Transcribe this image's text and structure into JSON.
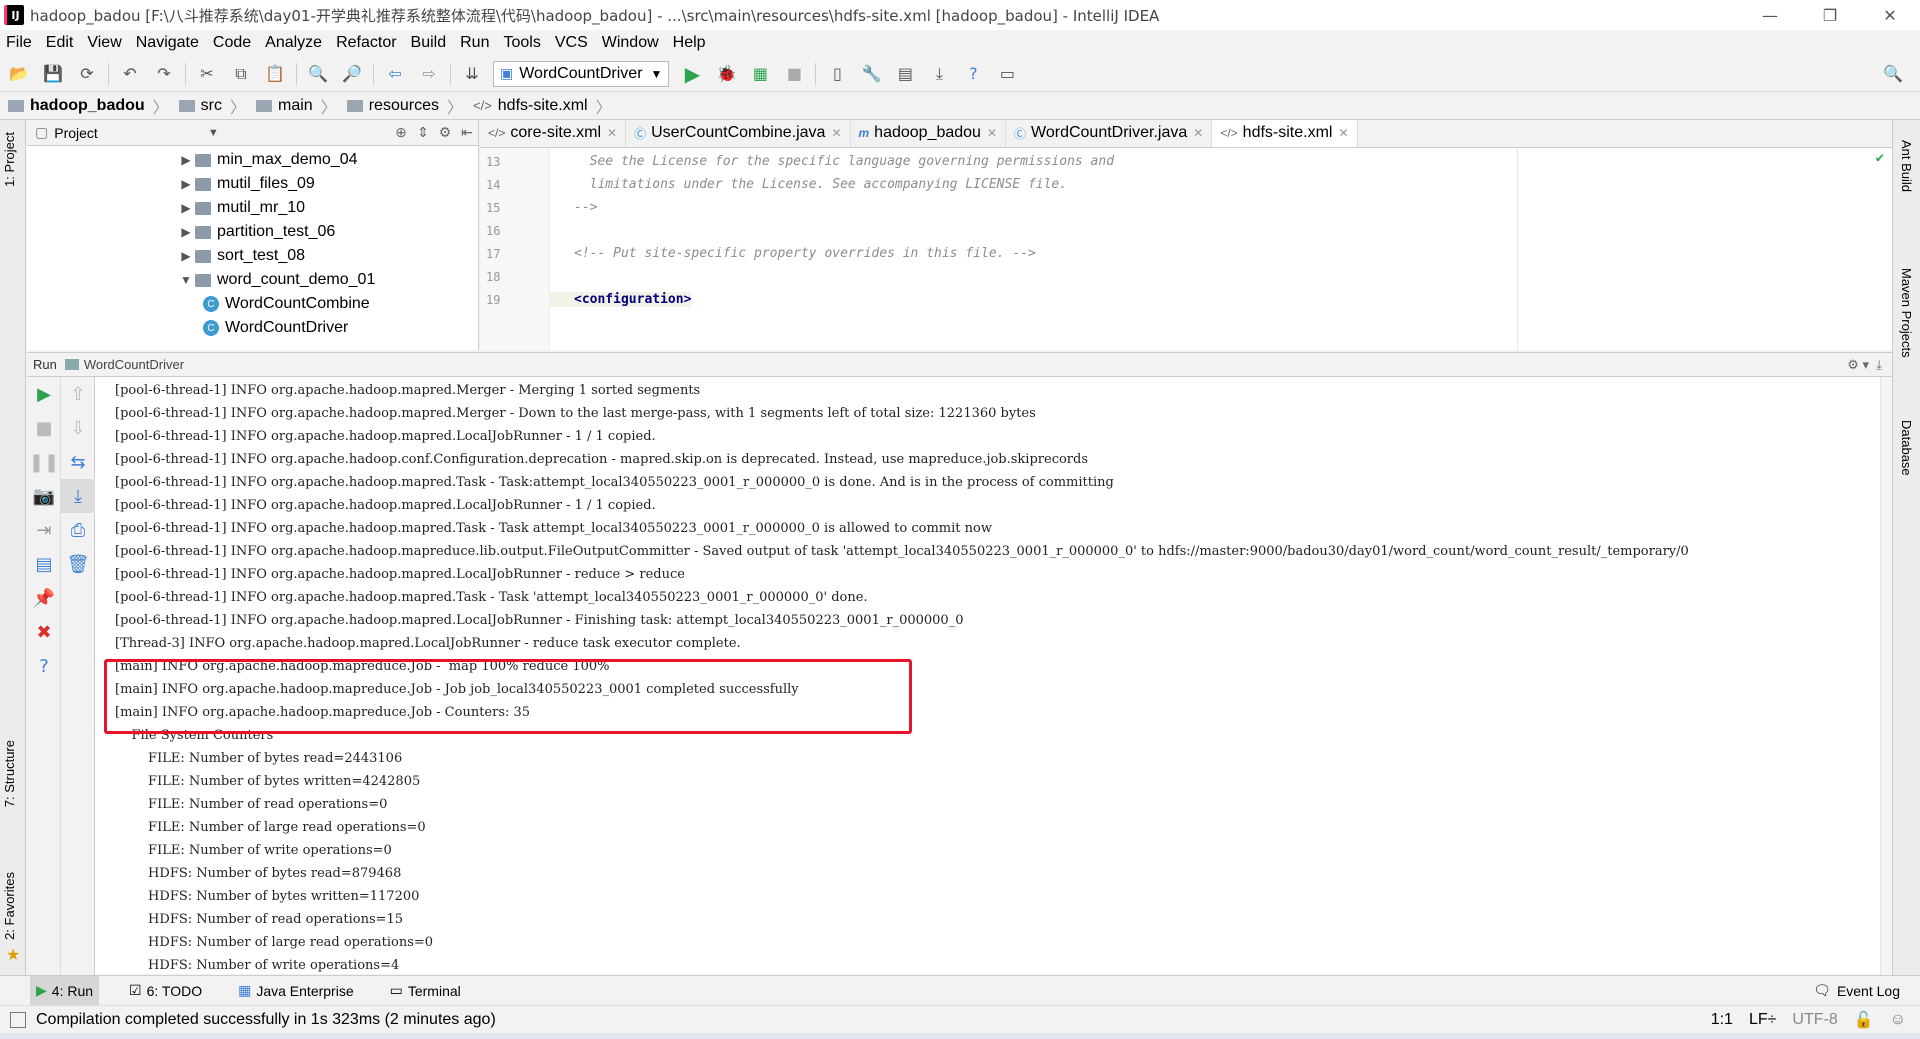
{
  "window": {
    "title": "hadoop_badou [F:\\八斗推荐系统\\day01-开学典礼推荐系统整体流程\\代码\\hadoop_badou] - ...\\src\\main\\resources\\hdfs-site.xml [hadoop_badou] - IntelliJ IDEA",
    "icon_label": "IJ"
  },
  "menu": [
    "File",
    "Edit",
    "View",
    "Navigate",
    "Code",
    "Analyze",
    "Refactor",
    "Build",
    "Run",
    "Tools",
    "VCS",
    "Window",
    "Help"
  ],
  "toolbar": {
    "run_config": "WordCountDriver"
  },
  "breadcrumb": [
    "hadoop_badou",
    "src",
    "main",
    "resources",
    "hdfs-site.xml"
  ],
  "left_stripe": {
    "project": "1: Project",
    "structure": "7: Structure",
    "favorites": "2: Favorites"
  },
  "right_stripe": {
    "ant": "Ant Build",
    "maven": "Maven Projects",
    "database": "Database"
  },
  "project_panel": {
    "title": "Project",
    "items": [
      {
        "label": "min_max_demo_04",
        "kind": "folder",
        "expanded": false
      },
      {
        "label": "mutil_files_09",
        "kind": "folder",
        "expanded": false
      },
      {
        "label": "mutil_mr_10",
        "kind": "folder",
        "expanded": false
      },
      {
        "label": "partition_test_06",
        "kind": "folder",
        "expanded": false
      },
      {
        "label": "sort_test_08",
        "kind": "folder",
        "expanded": false
      },
      {
        "label": "word_count_demo_01",
        "kind": "folder",
        "expanded": true
      },
      {
        "label": "WordCountCombine",
        "kind": "class"
      },
      {
        "label": "WordCountDriver",
        "kind": "class"
      }
    ]
  },
  "editor": {
    "tabs": [
      {
        "label": "core-site.xml",
        "icon": "xml-icon",
        "active": false
      },
      {
        "label": "UserCountCombine.java",
        "icon": "class-icon",
        "active": false
      },
      {
        "label": "hadoop_badou",
        "icon": "maven-icon",
        "active": false
      },
      {
        "label": "WordCountDriver.java",
        "icon": "class-icon",
        "active": false
      },
      {
        "label": "hdfs-site.xml",
        "icon": "xml-icon",
        "active": true
      }
    ],
    "lines": [
      {
        "no": "13",
        "text": "  See the License for the specific language governing permissions and",
        "kind": "comment"
      },
      {
        "no": "14",
        "text": "  limitations under the License. See accompanying LICENSE file.",
        "kind": "comment"
      },
      {
        "no": "15",
        "text": "-->",
        "kind": "comment"
      },
      {
        "no": "16",
        "text": "",
        "kind": "plain"
      },
      {
        "no": "17",
        "text": "<!-- Put site-specific property overrides in this file. -->",
        "kind": "comment"
      },
      {
        "no": "18",
        "text": "",
        "kind": "plain"
      },
      {
        "no": "19",
        "text": "<configuration>",
        "kind": "tag"
      }
    ]
  },
  "run_panel": {
    "label": "Run",
    "config": "WordCountDriver",
    "console": [
      "[pool-6-thread-1] INFO org.apache.hadoop.mapred.Merger - Merging 1 sorted segments",
      "[pool-6-thread-1] INFO org.apache.hadoop.mapred.Merger - Down to the last merge-pass, with 1 segments left of total size: 1221360 bytes",
      "[pool-6-thread-1] INFO org.apache.hadoop.mapred.LocalJobRunner - 1 / 1 copied.",
      "[pool-6-thread-1] INFO org.apache.hadoop.conf.Configuration.deprecation - mapred.skip.on is deprecated. Instead, use mapreduce.job.skiprecords",
      "[pool-6-thread-1] INFO org.apache.hadoop.mapred.Task - Task:attempt_local340550223_0001_r_000000_0 is done. And is in the process of committing",
      "[pool-6-thread-1] INFO org.apache.hadoop.mapred.LocalJobRunner - 1 / 1 copied.",
      "[pool-6-thread-1] INFO org.apache.hadoop.mapred.Task - Task attempt_local340550223_0001_r_000000_0 is allowed to commit now",
      "[pool-6-thread-1] INFO org.apache.hadoop.mapreduce.lib.output.FileOutputCommitter - Saved output of task 'attempt_local340550223_0001_r_000000_0' to hdfs://master:9000/badou30/day01/word_count/word_count_result/_temporary/0",
      "[pool-6-thread-1] INFO org.apache.hadoop.mapred.LocalJobRunner - reduce > reduce",
      "[pool-6-thread-1] INFO org.apache.hadoop.mapred.Task - Task 'attempt_local340550223_0001_r_000000_0' done.",
      "[pool-6-thread-1] INFO org.apache.hadoop.mapred.LocalJobRunner - Finishing task: attempt_local340550223_0001_r_000000_0",
      "[Thread-3] INFO org.apache.hadoop.mapred.LocalJobRunner - reduce task executor complete.",
      "[main] INFO org.apache.hadoop.mapreduce.Job -  map 100% reduce 100%",
      "[main] INFO org.apache.hadoop.mapreduce.Job - Job job_local340550223_0001 completed successfully",
      "[main] INFO org.apache.hadoop.mapreduce.Job - Counters: 35",
      "    File System Counters",
      "        FILE: Number of bytes read=2443106",
      "        FILE: Number of bytes written=4242805",
      "        FILE: Number of read operations=0",
      "        FILE: Number of large read operations=0",
      "        FILE: Number of write operations=0",
      "        HDFS: Number of bytes read=879468",
      "        HDFS: Number of bytes written=117200",
      "        HDFS: Number of read operations=15",
      "        HDFS: Number of large read operations=0",
      "        HDFS: Number of write operations=4"
    ]
  },
  "bottom_tabs": [
    {
      "label": "4: Run",
      "icon": "run-icon",
      "active": true
    },
    {
      "label": "6: TODO",
      "icon": "todo-icon",
      "active": false
    },
    {
      "label": "Java Enterprise",
      "icon": "java-enterprise-icon",
      "active": false
    },
    {
      "label": "Terminal",
      "icon": "terminal-icon",
      "active": false
    }
  ],
  "event_log": "Event Log",
  "status": {
    "message": "Compilation completed successfully in 1s 323ms (2 minutes ago)",
    "position": "1:1",
    "line_sep": "LF÷",
    "encoding": "UTF-8"
  },
  "colors": {
    "accent": "#3f7fd6",
    "highlight_box": "#e8132a",
    "run_green": "#2ea44f"
  }
}
